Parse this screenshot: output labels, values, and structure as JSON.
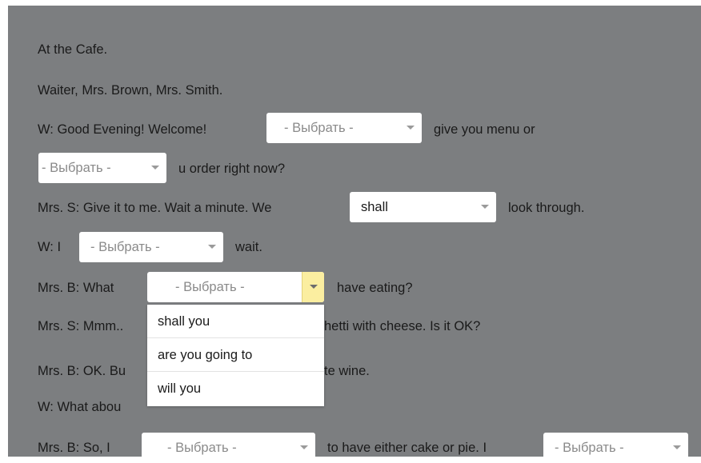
{
  "lines": {
    "title": "At the Cafe.",
    "characters": "Waiter, Mrs. Brown, Mrs. Smith.",
    "l3_prefix": "W: Good Evening! Welcome!",
    "l3_suffix": "give you menu or",
    "l4_suffix": "u order right now?",
    "l5_prefix": "Mrs. S: Give it to me. Wait a minute. We",
    "l5_suffix": "look through.",
    "l6_prefix": "W: I",
    "l6_suffix": "wait.",
    "l7_prefix": "Mrs. B: What",
    "l7_suffix": "have eating?",
    "l8_prefix": "Mrs. S: Mmm..",
    "l8_suffix": "hetti  with cheese. Is it OK?",
    "l9_prefix": "Mrs. B: OK. Bu",
    "l9_suffix": "te wine.",
    "l10": "W: What abou",
    "l11_prefix": "Mrs. B: So, I",
    "l11_middle": "to have either cake or pie. I"
  },
  "selects": {
    "s1": "- Выбрать -",
    "s2": "- Выбрать -",
    "s3": "shall",
    "s4": "- Выбрать -",
    "s5": "- Выбрать -",
    "s6": "- Выбрать -",
    "s7": "- Выбрать -"
  },
  "dropdown_options": [
    "shall you",
    "are you going to",
    "will you"
  ],
  "colors": {
    "background": "#7c7e80",
    "open_arrow": "#fbeea0"
  }
}
